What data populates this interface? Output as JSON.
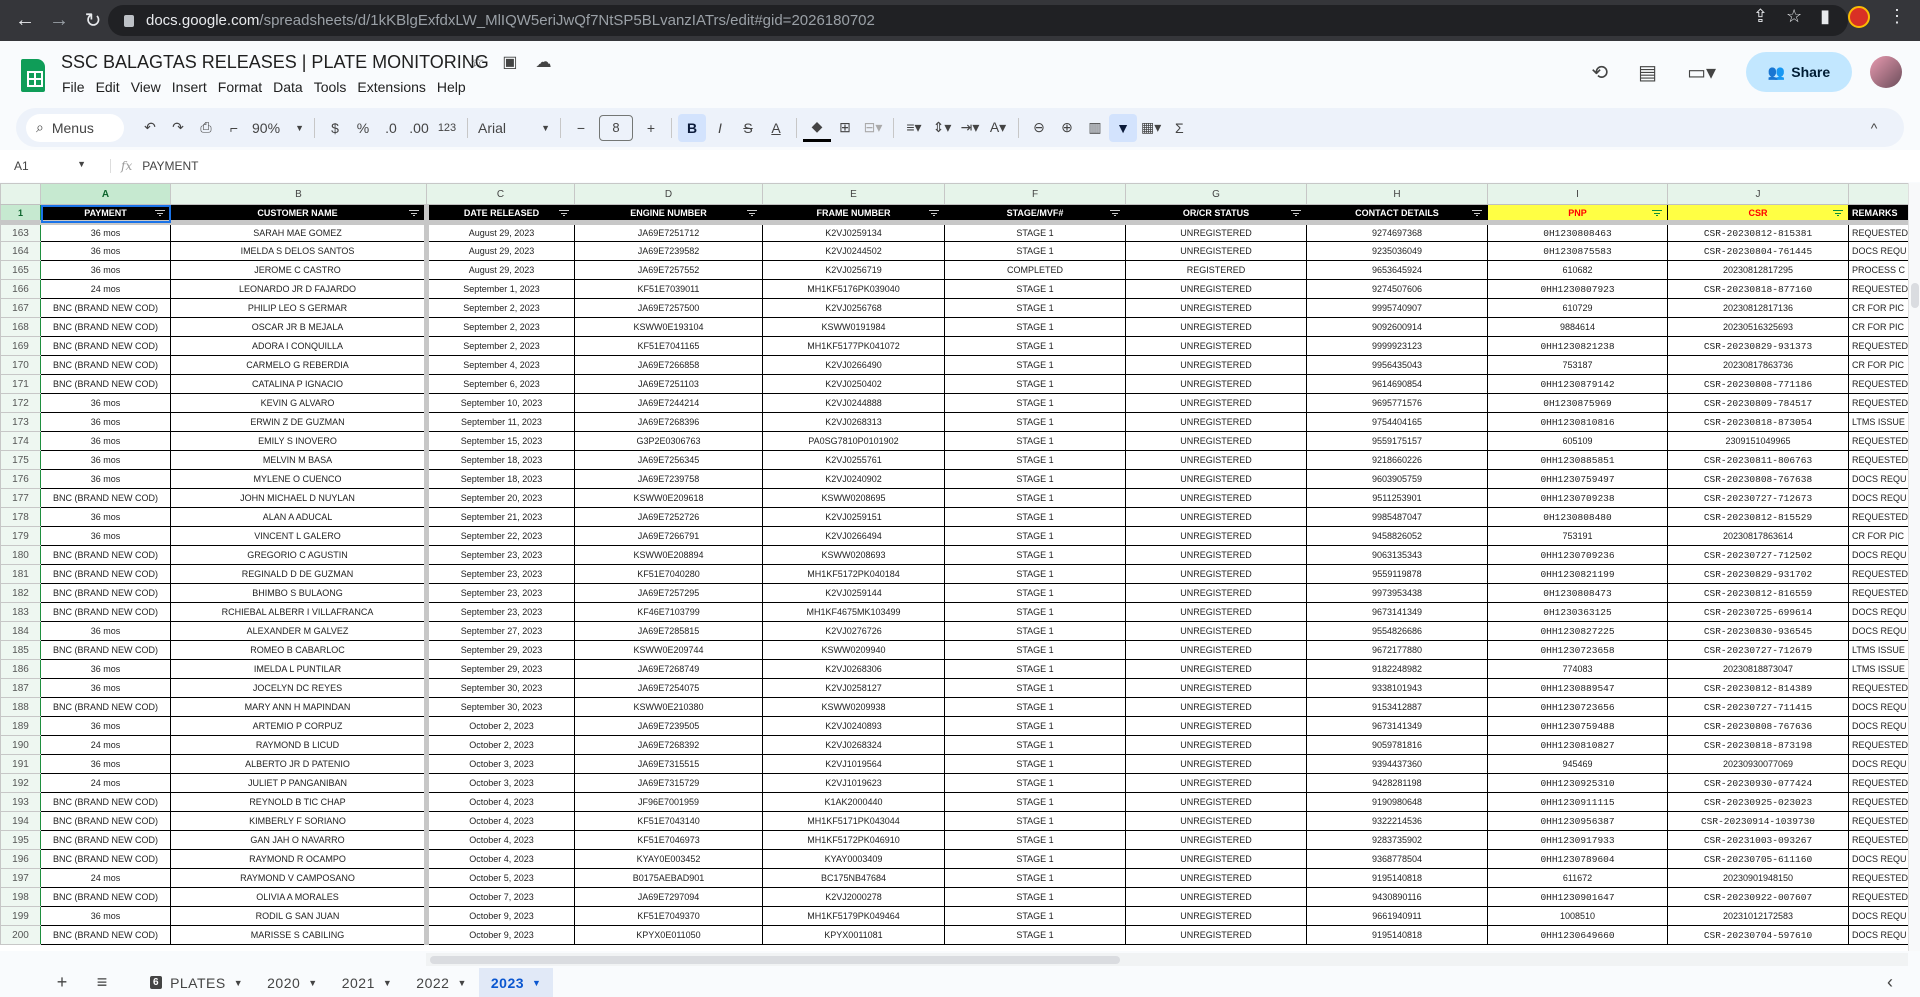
{
  "browser": {
    "url_host": "docs.google.com",
    "url_path": "/spreadsheets/d/1kKBlgExfdxLW_MlIQW5eriJwQf7NtSP5BLvanzIATrs/edit#gid=2026180702"
  },
  "doc": {
    "title": "SSC BALAGTAS RELEASES | PLATE MONITORING",
    "share_label": "Share"
  },
  "menu": [
    "File",
    "Edit",
    "View",
    "Insert",
    "Format",
    "Data",
    "Tools",
    "Extensions",
    "Help"
  ],
  "toolbar": {
    "search_label": "Menus",
    "zoom": "90%",
    "currency": "$",
    "percent": "%",
    "dec_less": ".0",
    "dec_more": ".00",
    "num_format": "123",
    "font": "Arial",
    "font_size": "8",
    "bold": "B",
    "italic": "I",
    "strike": "S",
    "text_color": "A",
    "sum": "Σ"
  },
  "formula_bar": {
    "cell_ref": "A1",
    "fx": "fx",
    "value": "PAYMENT"
  },
  "columns": [
    "A",
    "B",
    "C",
    "D",
    "E",
    "F",
    "G",
    "H",
    "I",
    "J"
  ],
  "header_row": {
    "row_num": "1",
    "labels": [
      "PAYMENT",
      "CUSTOMER NAME",
      "DATE RELEASED",
      "ENGINE NUMBER",
      "FRAME NUMBER",
      "STAGE/MVF#",
      "OR/CR STATUS",
      "CONTACT DETAILS",
      "PNP",
      "CSR",
      "REMARKS"
    ]
  },
  "colors": {
    "header_bg": "#000000",
    "highlight_header_bg": "#ffff44",
    "highlight_header_text": "#ff0000",
    "accent": "#0b57d0"
  },
  "rows": [
    [
      "163",
      "36 mos",
      "SARAH MAE GOMEZ",
      "August 29, 2023",
      "JA69E7251712",
      "K2VJ0259134",
      "STAGE 1",
      "UNREGISTERED",
      "9274697368",
      "0H1230808463",
      "CSR-20230812-815381",
      "REQUESTED"
    ],
    [
      "164",
      "36 mos",
      "IMELDA S DELOS SANTOS",
      "August 29, 2023",
      "JA69E7239582",
      "K2VJ0244502",
      "STAGE 1",
      "UNREGISTERED",
      "9235036049",
      "0H1230875583",
      "CSR-20230804-761445",
      "DOCS REQU"
    ],
    [
      "165",
      "36 mos",
      "JEROME C CASTRO",
      "August 29, 2023",
      "JA69E7257552",
      "K2VJ0256719",
      "COMPLETED",
      "REGISTERED",
      "9653645924",
      "610682",
      "20230812817295",
      "PROCESS C"
    ],
    [
      "166",
      "24 mos",
      "LEONARDO JR D FAJARDO",
      "September 1, 2023",
      "KF51E7039011",
      "MH1KF5176PK039040",
      "STAGE 1",
      "UNREGISTERED",
      "9274507606",
      "0HH1230807923",
      "CSR-20230818-877160",
      "REQUESTED"
    ],
    [
      "167",
      "BNC (BRAND NEW COD)",
      "PHILIP LEO S GERMAR",
      "September 2, 2023",
      "JA69E7257500",
      "K2VJ0256768",
      "STAGE 1",
      "UNREGISTERED",
      "9995740907",
      "610729",
      "20230812817136",
      "CR FOR PIC"
    ],
    [
      "168",
      "BNC (BRAND NEW COD)",
      "OSCAR JR B MEJALA",
      "September 2, 2023",
      "KSWW0E193104",
      "KSWW0191984",
      "STAGE 1",
      "UNREGISTERED",
      "9092600914",
      "9884614",
      "20230516325693",
      "CR FOR PIC"
    ],
    [
      "169",
      "BNC (BRAND NEW COD)",
      "ADORA I CONQUILLA",
      "September 2, 2023",
      "KF51E7041165",
      "MH1KF5177PK041072",
      "STAGE 1",
      "UNREGISTERED",
      "9999923123",
      "0HH1230821238",
      "CSR-20230829-931373",
      "REQUESTED"
    ],
    [
      "170",
      "BNC (BRAND NEW COD)",
      "CARMELO G REBERDIA",
      "September 4, 2023",
      "JA69E7266858",
      "K2VJ0266490",
      "STAGE 1",
      "UNREGISTERED",
      "9956435043",
      "753187",
      "20230817863736",
      "CR FOR PIC"
    ],
    [
      "171",
      "BNC (BRAND NEW COD)",
      "CATALINA P IGNACIO",
      "September 6, 2023",
      "JA69E7251103",
      "K2VJ0250402",
      "STAGE 1",
      "UNREGISTERED",
      "9614690854",
      "0HH1230879142",
      "CSR-20230808-771186",
      "REQUESTED"
    ],
    [
      "172",
      "36 mos",
      "KEVIN G ALVARO",
      "September 10, 2023",
      "JA69E7244214",
      "K2VJ0244888",
      "STAGE 1",
      "UNREGISTERED",
      "9695771576",
      "0H1230875969",
      "CSR-20230809-784517",
      "REQUESTED"
    ],
    [
      "173",
      "36 mos",
      "ERWIN Z DE GUZMAN",
      "September 11, 2023",
      "JA69E7268396",
      "K2VJ0268313",
      "STAGE 1",
      "UNREGISTERED",
      "9754404165",
      "0HH1230810816",
      "CSR-20230818-873054",
      "LTMS ISSUE"
    ],
    [
      "174",
      "36 mos",
      "EMILY S INOVERO",
      "September 15, 2023",
      "G3P2E0306763",
      "PA0SG7810P0101902",
      "STAGE 1",
      "UNREGISTERED",
      "9559175157",
      "605109",
      "2309151049965",
      "REQUESTED"
    ],
    [
      "175",
      "36 mos",
      "MELVIN M BASA",
      "September 18, 2023",
      "JA69E7256345",
      "K2VJ0255761",
      "STAGE 1",
      "UNREGISTERED",
      "9218660226",
      "0HH1230885851",
      "CSR-20230811-806763",
      "REQUESTED"
    ],
    [
      "176",
      "36 mos",
      "MYLENE O CUENCO",
      "September 18, 2023",
      "JA69E7239758",
      "K2VJ0240902",
      "STAGE 1",
      "UNREGISTERED",
      "9603905759",
      "0HH1230759497",
      "CSR-20230808-767638",
      "DOCS REQU"
    ],
    [
      "177",
      "BNC (BRAND NEW COD)",
      "JOHN MICHAEL D NUYLAN",
      "September 20, 2023",
      "KSWW0E209618",
      "KSWW0208695",
      "STAGE 1",
      "UNREGISTERED",
      "9511253901",
      "0HH1230709238",
      "CSR-20230727-712673",
      "DOCS REQU"
    ],
    [
      "178",
      "36 mos",
      "ALAN A ADUCAL",
      "September 21, 2023",
      "JA69E7252726",
      "K2VJ0259151",
      "STAGE 1",
      "UNREGISTERED",
      "9985487047",
      "0H1230808480",
      "CSR-20230812-815529",
      "REQUESTED"
    ],
    [
      "179",
      "36 mos",
      "VINCENT L GALERO",
      "September 22, 2023",
      "JA69E7266791",
      "K2VJ0266494",
      "STAGE 1",
      "UNREGISTERED",
      "9458826052",
      "753191",
      "20230817863614",
      "CR FOR PIC"
    ],
    [
      "180",
      "BNC (BRAND NEW COD)",
      "GREGORIO C AGUSTIN",
      "September 23, 2023",
      "KSWW0E208894",
      "KSWW0208693",
      "STAGE 1",
      "UNREGISTERED",
      "9063135343",
      "0HH1230709236",
      "CSR-20230727-712502",
      "DOCS REQU"
    ],
    [
      "181",
      "BNC (BRAND NEW COD)",
      "REGINALD D DE GUZMAN",
      "September 23, 2023",
      "KF51E7040280",
      "MH1KF5172PK040184",
      "STAGE 1",
      "UNREGISTERED",
      "9559119878",
      "0HH1230821199",
      "CSR-20230829-931702",
      "REQUESTED"
    ],
    [
      "182",
      "BNC (BRAND NEW COD)",
      "BHIMBO S BULAONG",
      "September 23, 2023",
      "JA69E7257295",
      "K2VJ0259144",
      "STAGE 1",
      "UNREGISTERED",
      "9973953438",
      "0H1230808473",
      "CSR-20230812-816559",
      "REQUESTED"
    ],
    [
      "183",
      "BNC (BRAND NEW COD)",
      "RCHIEBAL ALBERR I VILLAFRANCA",
      "September 23, 2023",
      "KF46E7103799",
      "MH1KF4675MK103499",
      "STAGE 1",
      "UNREGISTERED",
      "9673141349",
      "0H1230363125",
      "CSR-20230725-699614",
      "DOCS REQU"
    ],
    [
      "184",
      "36 mos",
      "ALEXANDER M GALVEZ",
      "September 27, 2023",
      "JA69E7285815",
      "K2VJ0276726",
      "STAGE 1",
      "UNREGISTERED",
      "9554826686",
      "0HH1230827225",
      "CSR-20230830-936545",
      "DOCS REQU"
    ],
    [
      "185",
      "BNC (BRAND NEW COD)",
      "ROMEO B CABARLOC",
      "September 29, 2023",
      "KSWW0E209744",
      "KSWW0209940",
      "STAGE 1",
      "UNREGISTERED",
      "9672177880",
      "0HH1230723658",
      "CSR-20230727-712679",
      "LTMS ISSUE"
    ],
    [
      "186",
      "36 mos",
      "IMELDA L PUNTILAR",
      "September 29, 2023",
      "JA69E7268749",
      "K2VJ0268306",
      "STAGE 1",
      "UNREGISTERED",
      "9182248982",
      "774083",
      "20230818873047",
      "LTMS ISSUE"
    ],
    [
      "187",
      "36 mos",
      "JOCELYN DC REYES",
      "September 30, 2023",
      "JA69E7254075",
      "K2VJ0258127",
      "STAGE 1",
      "UNREGISTERED",
      "9338101943",
      "0HH1230889547",
      "CSR-20230812-814389",
      "REQUESTED"
    ],
    [
      "188",
      "BNC (BRAND NEW COD)",
      "MARY ANN H MAPINDAN",
      "September 30, 2023",
      "KSWW0E210380",
      "KSWW0209938",
      "STAGE 1",
      "UNREGISTERED",
      "9153412887",
      "0HH1230723656",
      "CSR-20230727-711415",
      "DOCS REQU"
    ],
    [
      "189",
      "36 mos",
      "ARTEMIO P CORPUZ",
      "October 2, 2023",
      "JA69E7239505",
      "K2VJ0240893",
      "STAGE 1",
      "UNREGISTERED",
      "9673141349",
      "0HH1230759488",
      "CSR-20230808-767636",
      "DOCS REQU"
    ],
    [
      "190",
      "24 mos",
      "RAYMOND B LICUD",
      "October 2, 2023",
      "JA69E7268392",
      "K2VJ0268324",
      "STAGE 1",
      "UNREGISTERED",
      "9059781816",
      "0HH1230810827",
      "CSR-20230818-873198",
      "REQUESTED"
    ],
    [
      "191",
      "36 mos",
      "ALBERTO JR D PATENIO",
      "October 3, 2023",
      "JA69E7315515",
      "K2VJ1019564",
      "STAGE 1",
      "UNREGISTERED",
      "9394437360",
      "945469",
      "20230930077069",
      "DOCS REQU"
    ],
    [
      "192",
      "24 mos",
      "JULIET P PANGANIBAN",
      "October 3, 2023",
      "JA69E7315729",
      "K2VJ1019623",
      "STAGE 1",
      "UNREGISTERED",
      "9428281198",
      "0HH1230925310",
      "CSR-20230930-077424",
      "REQUESTED"
    ],
    [
      "193",
      "BNC (BRAND NEW COD)",
      "REYNOLD B TIC CHAP",
      "October 4, 2023",
      "JF96E7001959",
      "K1AK2000440",
      "STAGE 1",
      "UNREGISTERED",
      "9190980648",
      "0HH1230911115",
      "CSR-20230925-023023",
      "REQUESTED"
    ],
    [
      "194",
      "BNC (BRAND NEW COD)",
      "KIMBERLY F SORIANO",
      "October 4, 2023",
      "KF51E7043140",
      "MH1KF5171PK043044",
      "STAGE 1",
      "UNREGISTERED",
      "9322214536",
      "0HH1230956387",
      "CSR-20230914-1039730",
      "REQUESTED"
    ],
    [
      "195",
      "BNC (BRAND NEW COD)",
      "GAN JAH O NAVARRO",
      "October 4, 2023",
      "KF51E7046973",
      "MH1KF5172PK046910",
      "STAGE 1",
      "UNREGISTERED",
      "9283735902",
      "0HH1230917933",
      "CSR-20231003-093267",
      "REQUESTED"
    ],
    [
      "196",
      "BNC (BRAND NEW COD)",
      "RAYMOND R OCAMPO",
      "October 4, 2023",
      "KYAY0E003452",
      "KYAY0003409",
      "STAGE 1",
      "UNREGISTERED",
      "9368778504",
      "0HH1230789604",
      "CSR-20230705-611160",
      "DOCS REQU"
    ],
    [
      "197",
      "24 mos",
      "RAYMOND V CAMPOSANO",
      "October 5, 2023",
      "B0175AEBAD901",
      "BC175NB47684",
      "STAGE 1",
      "UNREGISTERED",
      "9195140818",
      "611672",
      "20230901948150",
      "REQUESTED"
    ],
    [
      "198",
      "BNC (BRAND NEW COD)",
      "OLIVIA A MORALES",
      "October 7, 2023",
      "JA69E7297094",
      "K2VJ2000278",
      "STAGE 1",
      "UNREGISTERED",
      "9430890116",
      "0HH1230901647",
      "CSR-20230922-007607",
      "REQUESTED"
    ],
    [
      "199",
      "36 mos",
      "RODIL G SAN JUAN",
      "October 9, 2023",
      "KF51E7049370",
      "MH1KF5179PK049464",
      "STAGE 1",
      "UNREGISTERED",
      "9661940911",
      "1008510",
      "20231012172583",
      "DOCS REQU"
    ],
    [
      "200",
      "BNC (BRAND NEW COD)",
      "MARISSE S CABILING",
      "October 9, 2023",
      "KPYX0E011050",
      "KPYX0011081",
      "STAGE 1",
      "UNREGISTERED",
      "9195140818",
      "0HH1230649660",
      "CSR-20230704-597610",
      "DOCS REQU"
    ]
  ],
  "sheet_tabs": [
    {
      "label": "PLATES",
      "badge": "6"
    },
    {
      "label": "2020"
    },
    {
      "label": "2021"
    },
    {
      "label": "2022"
    },
    {
      "label": "2023",
      "active": true
    }
  ]
}
